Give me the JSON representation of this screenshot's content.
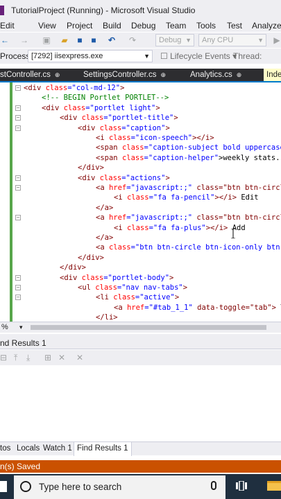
{
  "window": {
    "title": "TutorialProject (Running) - Microsoft Visual Studio"
  },
  "menu": [
    "Edit",
    "View",
    "Project",
    "Build",
    "Debug",
    "Team",
    "Tools",
    "Test",
    "Analyze"
  ],
  "toolbar": {
    "config_combo": "Debug",
    "platform_combo": "Any CPU"
  },
  "process_bar": {
    "label": "Process:",
    "process_value": "[7292] iisexpress.exe",
    "lifecycle_label": "Lifecycle Events",
    "thread_label": "Thread:"
  },
  "doc_tabs": [
    {
      "label": "stController.cs",
      "close": "⊕"
    },
    {
      "label": "SettingsController.cs",
      "close": "⊕"
    },
    {
      "label": "Analytics.cs",
      "close": "⊕"
    },
    {
      "label": "Inde",
      "close": ""
    }
  ],
  "code_lines": [
    [
      "<div ",
      "class",
      "=\"col-md-12\"",
      ">"
    ],
    [
      "<!-- BEGIN Portlet PORTLET-->"
    ],
    [
      "<div ",
      "class",
      "=\"portlet light\"",
      ">"
    ],
    [
      "<div ",
      "class",
      "=\"portlet-title\"",
      ">"
    ],
    [
      "<div ",
      "class",
      "=\"caption\"",
      ">"
    ],
    [
      "<i ",
      "class",
      "=\"icon-speech\"",
      "></i>"
    ],
    [
      "<span ",
      "class",
      "=\"caption-subject bold uppercase",
      ""
    ],
    [
      "<span ",
      "class",
      "=\"caption-helper\"",
      ">weekly stats..."
    ],
    [
      "</div>"
    ],
    [
      "<div ",
      "class",
      "=\"actions\"",
      ">"
    ],
    [
      "<a ",
      "href",
      "=\"javascript:;\"",
      " class=\"btn btn-circl"
    ],
    [
      "<i ",
      "class",
      "=\"fa fa-pencil\"",
      "></i> Edit"
    ],
    [
      "</a>"
    ],
    [
      "<a ",
      "href",
      "=\"javascript:;\"",
      " class=\"btn btn-circl"
    ],
    [
      "<i ",
      "class",
      "=\"fa fa-plus\"",
      "></i> Add"
    ],
    [
      "</a>"
    ],
    [
      "<a ",
      "class",
      "=\"btn btn-circle btn-icon-only btn-",
      ""
    ],
    [
      "</div>"
    ],
    [
      "</div>"
    ],
    [
      "<div ",
      "class",
      "=\"portlet-body\"",
      ">"
    ],
    [
      "<ul ",
      "class",
      "=\"nav nav-tabs\"",
      ">"
    ],
    [
      "<li ",
      "class",
      "=\"active\"",
      ">"
    ],
    [
      "<a ",
      "href",
      "=\"#tab_1_1\"",
      " data-toggle=\"tab\"> T"
    ],
    [
      "</li>"
    ]
  ],
  "editor_status": {
    "zoom": "%"
  },
  "find_results": {
    "title": "nd Results 1"
  },
  "tool_tabs": [
    {
      "label": "tos"
    },
    {
      "label": "Locals"
    },
    {
      "label": "Watch 1"
    },
    {
      "label": "Find Results 1"
    }
  ],
  "status_bar": {
    "message": "n(s) Saved"
  },
  "taskbar": {
    "search_placeholder": "Type here to search"
  },
  "colors": {
    "chrome_bg": "#eeeef2",
    "tab_strip": "#2d2d30",
    "active_tab": "#fefcc8",
    "status_bar": "#ca5100",
    "taskbar": "#1f2f3f",
    "html_tag": "#800000",
    "html_attr": "#ff0000",
    "html_value": "#0000ff",
    "comment": "#008000"
  }
}
